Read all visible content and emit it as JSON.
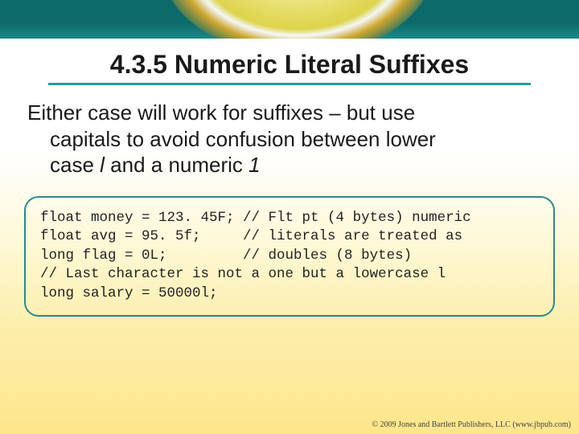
{
  "heading": "4.3.5 Numeric Literal Suffixes",
  "body": {
    "line1": "Either case will work for suffixes – but use",
    "line2a": "capitals to avoid confusion between lower",
    "line2b": "case ",
    "italic_l": "l",
    "mid": " and a numeric ",
    "italic_1": "1"
  },
  "code": {
    "l1": "float money = 123. 45F; // Flt pt (4 bytes) numeric",
    "l2": "float avg = 95. 5f;     // literals are treated as",
    "l3": "long flag = 0L;         // doubles (8 bytes)",
    "l4": "// Last character is not a one but a lowercase l",
    "l5": "long salary = 50000l;"
  },
  "footer": "© 2009 Jones and Bartlett Publishers, LLC (www.jbpub.com)"
}
